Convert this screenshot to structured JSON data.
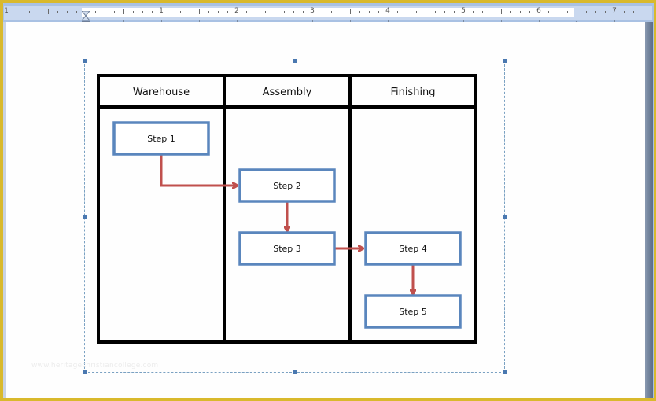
{
  "ruler": {
    "numbers": [
      "1",
      "1",
      "2",
      "3",
      "4",
      "5",
      "6",
      "7"
    ]
  },
  "diagram": {
    "lanes": [
      {
        "label": "Warehouse"
      },
      {
        "label": "Assembly"
      },
      {
        "label": "Finishing"
      }
    ],
    "steps": [
      {
        "label": "Step 1",
        "lane": 0
      },
      {
        "label": "Step 2",
        "lane": 1
      },
      {
        "label": "Step 3",
        "lane": 1
      },
      {
        "label": "Step 4",
        "lane": 2
      },
      {
        "label": "Step 5",
        "lane": 2
      }
    ],
    "colors": {
      "lane_border": "#000000",
      "step_border": "#5a86bd",
      "arrow": "#c0504d"
    }
  },
  "watermark": "www.heritagechristiancollege.com"
}
